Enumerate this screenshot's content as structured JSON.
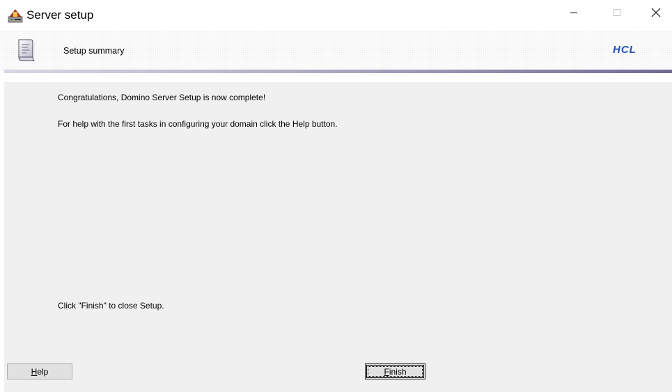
{
  "window": {
    "title": "Server setup",
    "app_icon": "server-setup-icon",
    "controls": {
      "minimize_icon": "minimize-icon",
      "maximize_icon": "maximize-icon",
      "close_icon": "close-icon"
    }
  },
  "header": {
    "icon": "document-icon",
    "title": "Setup summary",
    "logo_text": "HCL"
  },
  "body": {
    "congrats": "Congratulations, Domino Server Setup is now complete!",
    "help_hint": "For help with the first tasks in configuring your domain click the Help button.",
    "finish_hint": "Click \"Finish\" to close Setup."
  },
  "buttons": {
    "help": {
      "mnemonic": "H",
      "rest": "elp"
    },
    "finish": {
      "mnemonic": "F",
      "rest": "inish"
    }
  },
  "colors": {
    "panel_bg": "#f0f0f0",
    "logo": "#1d52b8",
    "rule_end": "#706b96"
  }
}
